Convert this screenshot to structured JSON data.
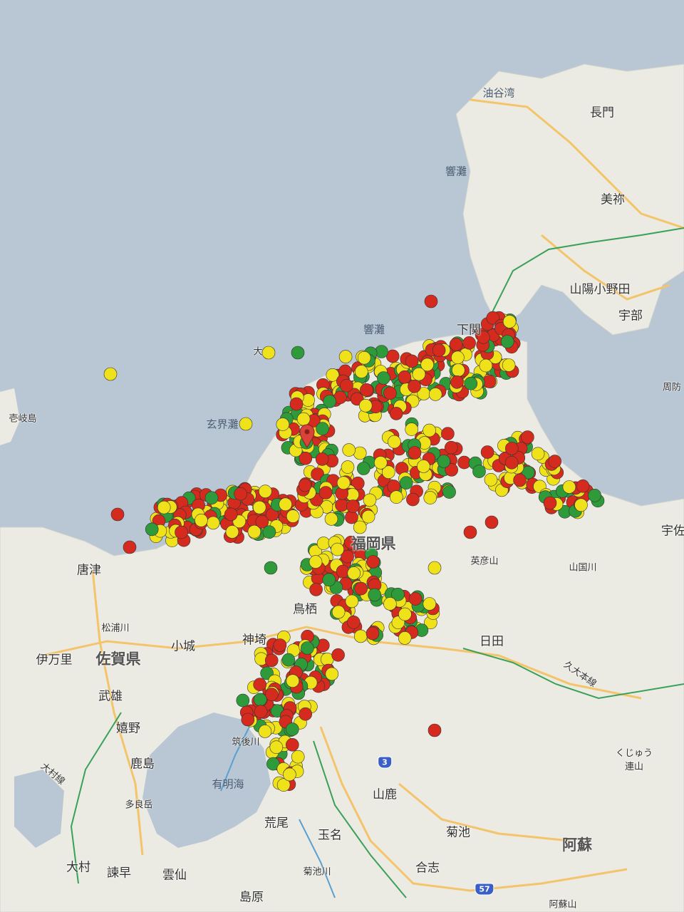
{
  "map": {
    "labels": [
      {
        "id": "aburatani",
        "text": "油谷湾",
        "kind": "sea"
      },
      {
        "id": "hibikinada-n",
        "text": "響灘",
        "kind": "sea"
      },
      {
        "id": "hibikinada-s",
        "text": "響灘",
        "kind": "sea"
      },
      {
        "id": "genkainada",
        "text": "玄界灘",
        "kind": "sea"
      },
      {
        "id": "ariake",
        "text": "有明海",
        "kind": "sea"
      },
      {
        "id": "iki",
        "text": "壱岐島",
        "kind": "small"
      },
      {
        "id": "nagato",
        "text": "長門",
        "kind": "city"
      },
      {
        "id": "mine",
        "text": "美祢",
        "kind": "city"
      },
      {
        "id": "sanyo",
        "text": "山陽小野田",
        "kind": "city"
      },
      {
        "id": "ube",
        "text": "宇部",
        "kind": "city"
      },
      {
        "id": "shimonoseki",
        "text": "下関",
        "kind": "city"
      },
      {
        "id": "suo",
        "text": "周防",
        "kind": "small"
      },
      {
        "id": "oshima",
        "text": "大",
        "kind": "small"
      },
      {
        "id": "fukuoka-pref",
        "text": "福岡県",
        "kind": "big"
      },
      {
        "id": "hikosan",
        "text": "英彦山",
        "kind": "small"
      },
      {
        "id": "yamakuni",
        "text": "山国川",
        "kind": "small"
      },
      {
        "id": "usa",
        "text": "宇佐",
        "kind": "city"
      },
      {
        "id": "karatsu",
        "text": "唐津",
        "kind": "city"
      },
      {
        "id": "matsuura",
        "text": "松浦川",
        "kind": "small"
      },
      {
        "id": "imari",
        "text": "伊万里",
        "kind": "city"
      },
      {
        "id": "saga-pref",
        "text": "佐賀県",
        "kind": "big"
      },
      {
        "id": "ogi",
        "text": "小城",
        "kind": "city"
      },
      {
        "id": "kanzaki",
        "text": "神埼",
        "kind": "city"
      },
      {
        "id": "tosu",
        "text": "鳥栖",
        "kind": "city"
      },
      {
        "id": "hita",
        "text": "日田",
        "kind": "city"
      },
      {
        "id": "kyudai",
        "text": "久大本線",
        "kind": "small"
      },
      {
        "id": "takeo",
        "text": "武雄",
        "kind": "city"
      },
      {
        "id": "ureshino",
        "text": "嬉野",
        "kind": "city"
      },
      {
        "id": "kashima",
        "text": "鹿島",
        "kind": "city"
      },
      {
        "id": "chikugo",
        "text": "筑後川",
        "kind": "small"
      },
      {
        "id": "omura-line",
        "text": "大村線",
        "kind": "small"
      },
      {
        "id": "taradake",
        "text": "多良岳",
        "kind": "small"
      },
      {
        "id": "kuju",
        "text": "くじゅう\n連山",
        "kind": "small"
      },
      {
        "id": "yamaga",
        "text": "山鹿",
        "kind": "city"
      },
      {
        "id": "arao",
        "text": "荒尾",
        "kind": "city"
      },
      {
        "id": "tamana",
        "text": "玉名",
        "kind": "city"
      },
      {
        "id": "kikuchi",
        "text": "菊池",
        "kind": "city"
      },
      {
        "id": "aso",
        "text": "阿蘇",
        "kind": "big"
      },
      {
        "id": "kikuchi-r",
        "text": "菊池川",
        "kind": "small"
      },
      {
        "id": "koshi",
        "text": "合志",
        "kind": "city"
      },
      {
        "id": "omura",
        "text": "大村",
        "kind": "city"
      },
      {
        "id": "isahaya",
        "text": "諫早",
        "kind": "city"
      },
      {
        "id": "unzen",
        "text": "雲仙",
        "kind": "city"
      },
      {
        "id": "shimabara",
        "text": "島原",
        "kind": "city"
      },
      {
        "id": "asosan",
        "text": "阿蘇山",
        "kind": "small"
      }
    ],
    "shields": [
      {
        "id": "r3",
        "text": "3"
      },
      {
        "id": "r57",
        "text": "57"
      }
    ],
    "colors": {
      "sea": "#b9c6d3",
      "land": "#ecebe3",
      "road": "#f3c46a",
      "rail": "#3aa05a",
      "red": "#d42b1e",
      "yellow": "#f0e21a",
      "green": "#2e9a3a",
      "marker": "#d9443a"
    }
  }
}
